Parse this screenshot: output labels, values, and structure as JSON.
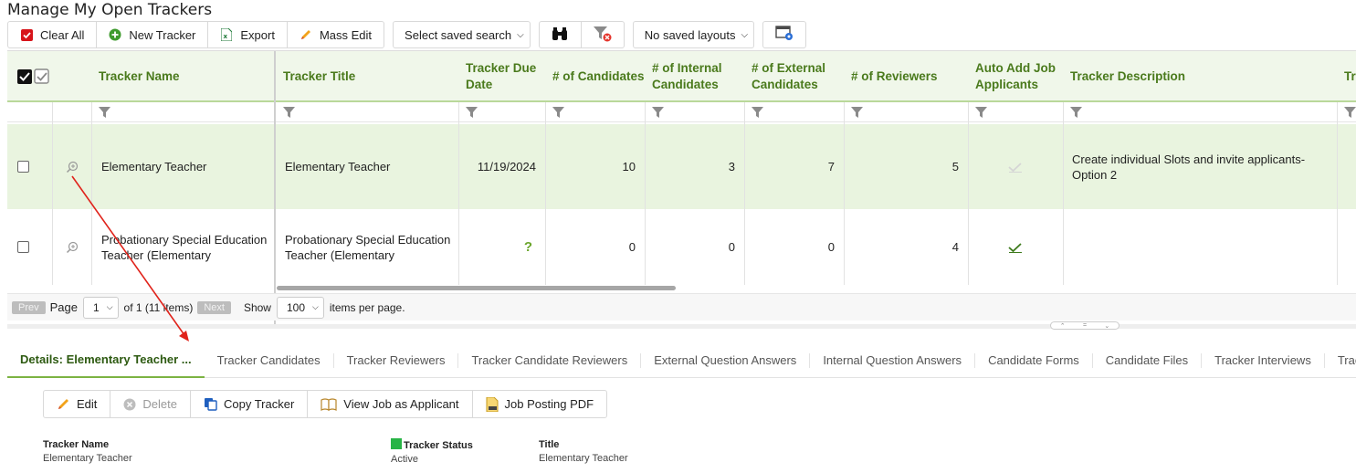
{
  "page_title": "Manage My Open Trackers",
  "toolbar": {
    "clear_all": "Clear All",
    "new_tracker": "New Tracker",
    "export": "Export",
    "mass_edit": "Mass Edit",
    "saved_search": "Select saved search",
    "saved_layouts": "No saved layouts"
  },
  "grid": {
    "columns": [
      "Tracker Name",
      "Tracker Title",
      "Tracker Due Date",
      "# of Candidates",
      "# of Internal Candidates",
      "# of External Candidates",
      "# of Reviewers",
      "Auto Add Job Applicants",
      "Tracker Description",
      "Tra"
    ],
    "rows": [
      {
        "name": "Elementary Teacher",
        "title": "Elementary Teacher",
        "due_date": "11/19/2024",
        "candidates": "10",
        "internal": "3",
        "external": "7",
        "reviewers": "5",
        "description": "Create individual Slots and invite applicants- Option 2"
      },
      {
        "name": "Probationary Special Education Teacher (Elementary",
        "title": "Probationary Special Education Teacher (Elementary",
        "due_date": "?",
        "candidates": "0",
        "internal": "0",
        "external": "0",
        "reviewers": "4",
        "description": ""
      }
    ]
  },
  "pager": {
    "prev": "Prev",
    "page_label": "Page",
    "page_value": "1",
    "of_text": "of 1 (11 items)",
    "next": "Next",
    "show_label": "Show",
    "page_size": "100",
    "per_page": "items per page."
  },
  "tabs": [
    "Details: Elementary Teacher ...",
    "Tracker Candidates",
    "Tracker Reviewers",
    "Tracker Candidate Reviewers",
    "External Question Answers",
    "Internal Question Answers",
    "Candidate Forms",
    "Candidate Files",
    "Tracker Interviews",
    "Tracker Files"
  ],
  "detail_toolbar": {
    "edit": "Edit",
    "delete": "Delete",
    "copy": "Copy Tracker",
    "view_job": "View Job as Applicant",
    "pdf": "Job Posting PDF"
  },
  "details": {
    "tracker_name_label": "Tracker Name",
    "tracker_name": "Elementary Teacher",
    "status_label": "Tracker Status",
    "status": "Active",
    "title_label": "Title",
    "title": "Elementary Teacher"
  },
  "colors": {
    "accent_green": "#4a7a1c",
    "row_highlight": "#e9f4df",
    "status_active": "#28b446",
    "annotation_arrow": "#e0231b"
  }
}
